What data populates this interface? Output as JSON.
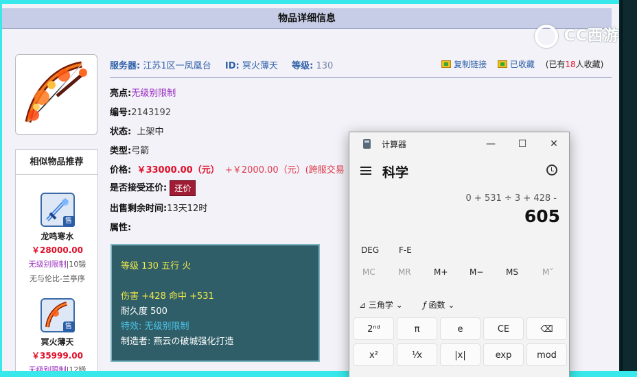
{
  "page": {
    "title": "物品详细信息",
    "watermark": "CC西游"
  },
  "summary": {
    "server_label": "服务器:",
    "server_value": "江苏1区一凤凰台",
    "id_label": "ID:",
    "id_value": "冥火薄天",
    "level_label": "等级:",
    "level_value": "130"
  },
  "actions": {
    "copy_link": "复制链接",
    "favorited": "已收藏",
    "fav_count_prefix": "(已有",
    "fav_count": "18",
    "fav_count_suffix": "人收藏)"
  },
  "details": {
    "highlight_label": "亮点:",
    "highlight_value": "无级别限制",
    "number_label": "编号:",
    "number_value": "2143192",
    "status_label": "状态:",
    "status_value": "上架中",
    "type_label": "类型:",
    "type_value": "弓箭",
    "price_label": "价格:",
    "price_value": "￥33000.00（元）",
    "price_extra": "+￥2000.00（元）(跨服交易",
    "counter_label": "是否接受还价:",
    "counter_button": "还价",
    "time_label": "出售剩余时间:",
    "time_value": "13天12时",
    "attr_label": "属性:"
  },
  "attributes": {
    "line1": "等级 130 五行 火",
    "line2": "伤害 +428 命中 +531",
    "line3": "耐久度 500",
    "line4": "特效: 无级别限制",
    "line5": "制造者: 燕云の破城强化打造"
  },
  "similar": {
    "title": "相似物品推荐",
    "sell_tag": "售",
    "items": [
      {
        "name": "龙鸣寒水",
        "price": "￥28000.00",
        "tag": "无级别限制",
        "level": "|10锻",
        "server": "无与伦比-兰亭序"
      },
      {
        "name": "冥火薄天",
        "price": "￥35999.00",
        "tag": "无级别限制",
        "level": "|12锻"
      }
    ]
  },
  "calculator": {
    "app_title": "计算器",
    "minimize": "—",
    "maximize": "☐",
    "close": "✕",
    "mode": "科学",
    "expression": "0 + 531 ÷ 3 + 428 -",
    "result": "605",
    "deg": "DEG",
    "fe": "F-E",
    "memory": [
      "MC",
      "MR",
      "M+",
      "M−",
      "MS",
      "M˅"
    ],
    "trig": "三角学",
    "func": "函数",
    "keys_row1": [
      "2ⁿᵈ",
      "π",
      "e",
      "CE",
      "⌫"
    ],
    "keys_row2": [
      "x²",
      "¹⁄x",
      "|x|",
      "exp",
      "mod"
    ]
  }
}
